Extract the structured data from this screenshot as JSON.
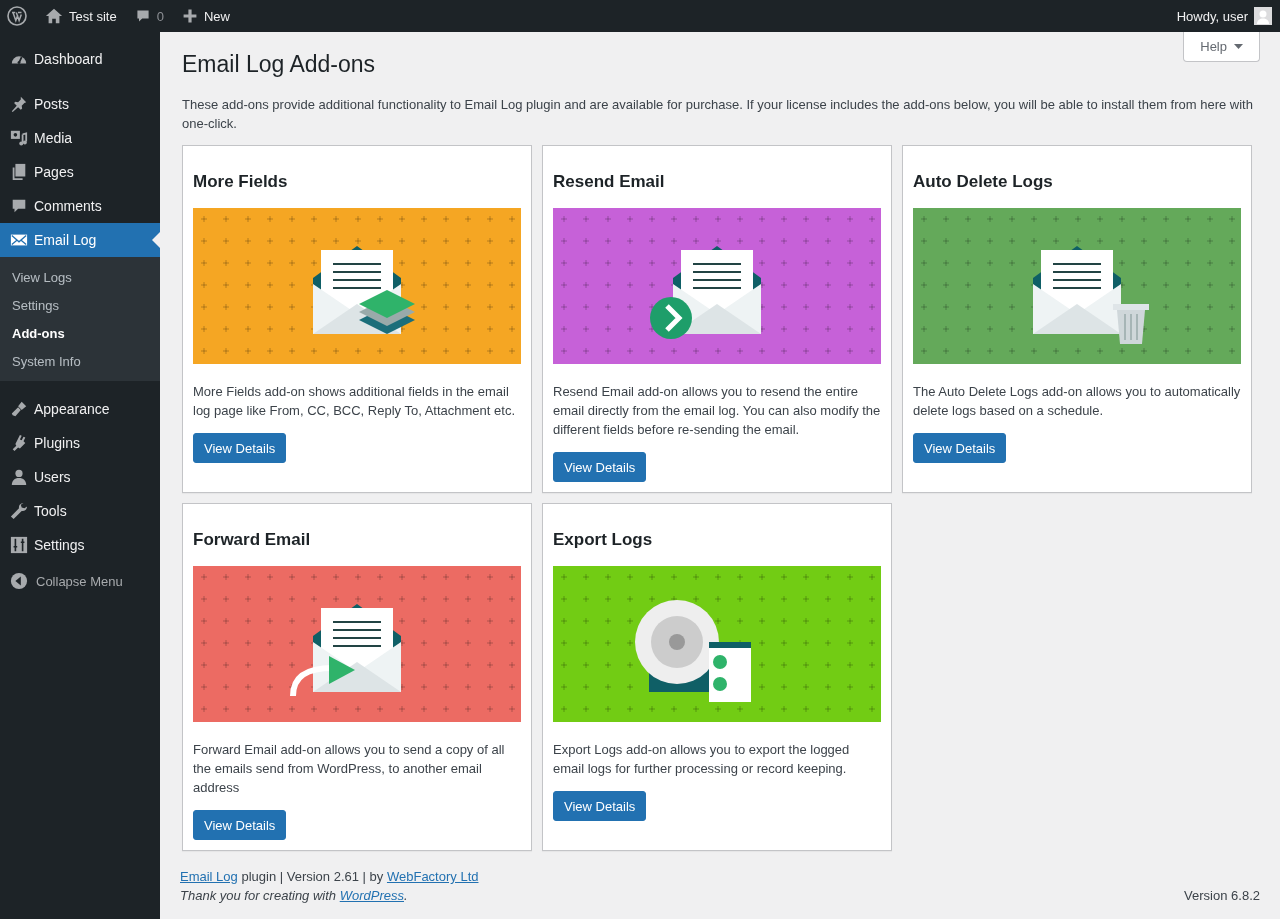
{
  "admin_bar": {
    "site_name": "Test site",
    "comments_count": "0",
    "new_label": "New",
    "greeting": "Howdy, user"
  },
  "sidebar": {
    "items": [
      {
        "label": "Dashboard",
        "selected": false
      },
      {
        "label": "Posts",
        "selected": false
      },
      {
        "label": "Media",
        "selected": false
      },
      {
        "label": "Pages",
        "selected": false
      },
      {
        "label": "Comments",
        "selected": false
      },
      {
        "label": "Email Log",
        "selected": true,
        "expanded": true,
        "children": [
          {
            "label": "View Logs",
            "selected": false
          },
          {
            "label": "Settings",
            "selected": false
          },
          {
            "label": "Add-ons",
            "selected": true
          },
          {
            "label": "System Info",
            "selected": false
          }
        ]
      },
      {
        "label": "Appearance",
        "selected": false
      },
      {
        "label": "Plugins",
        "selected": false
      },
      {
        "label": "Users",
        "selected": false
      },
      {
        "label": "Tools",
        "selected": false
      },
      {
        "label": "Settings",
        "selected": false
      }
    ],
    "collapse_label": "Collapse Menu"
  },
  "help_button": "Help",
  "page_title": "Email Log Add-ons",
  "intro": "These add-ons provide additional functionality to Email Log plugin and are available for purchase. If your license includes the add-ons below, you will be able to install them from here with one-click.",
  "addons": [
    {
      "title": "More Fields",
      "color": "#f5a623",
      "description": "More Fields add-on shows additional fields in the email log page like From, CC, BCC, Reply To, Attachment etc.",
      "button": "View Details"
    },
    {
      "title": "Resend Email",
      "color": "#c661d8",
      "description": "Resend Email add-on allows you to resend the entire email directly from the email log. You can also modify the different fields before re-sending the email.",
      "button": "View Details"
    },
    {
      "title": "Auto Delete Logs",
      "color": "#64a95a",
      "description": "The Auto Delete Logs add-on allows you to automatically delete logs based on a schedule.",
      "button": "View Details"
    },
    {
      "title": "Forward Email",
      "color": "#ec6b63",
      "description": "Forward Email add-on allows you to send a copy of all the emails send from WordPress, to another email address",
      "button": "View Details"
    },
    {
      "title": "Export Logs",
      "color": "#72cc14",
      "description": "Export Logs add-on allows you to export the logged email logs for further processing or record keeping.",
      "button": "View Details"
    }
  ],
  "footer": {
    "plugin_link": "Email Log",
    "plugin_text": " plugin | Version 2.61 | by ",
    "author_link": "WebFactory Ltd",
    "thanks_text": "Thank you for creating with ",
    "wp_link": "WordPress",
    "thanks_end": ".",
    "version": "Version 6.8.2"
  }
}
